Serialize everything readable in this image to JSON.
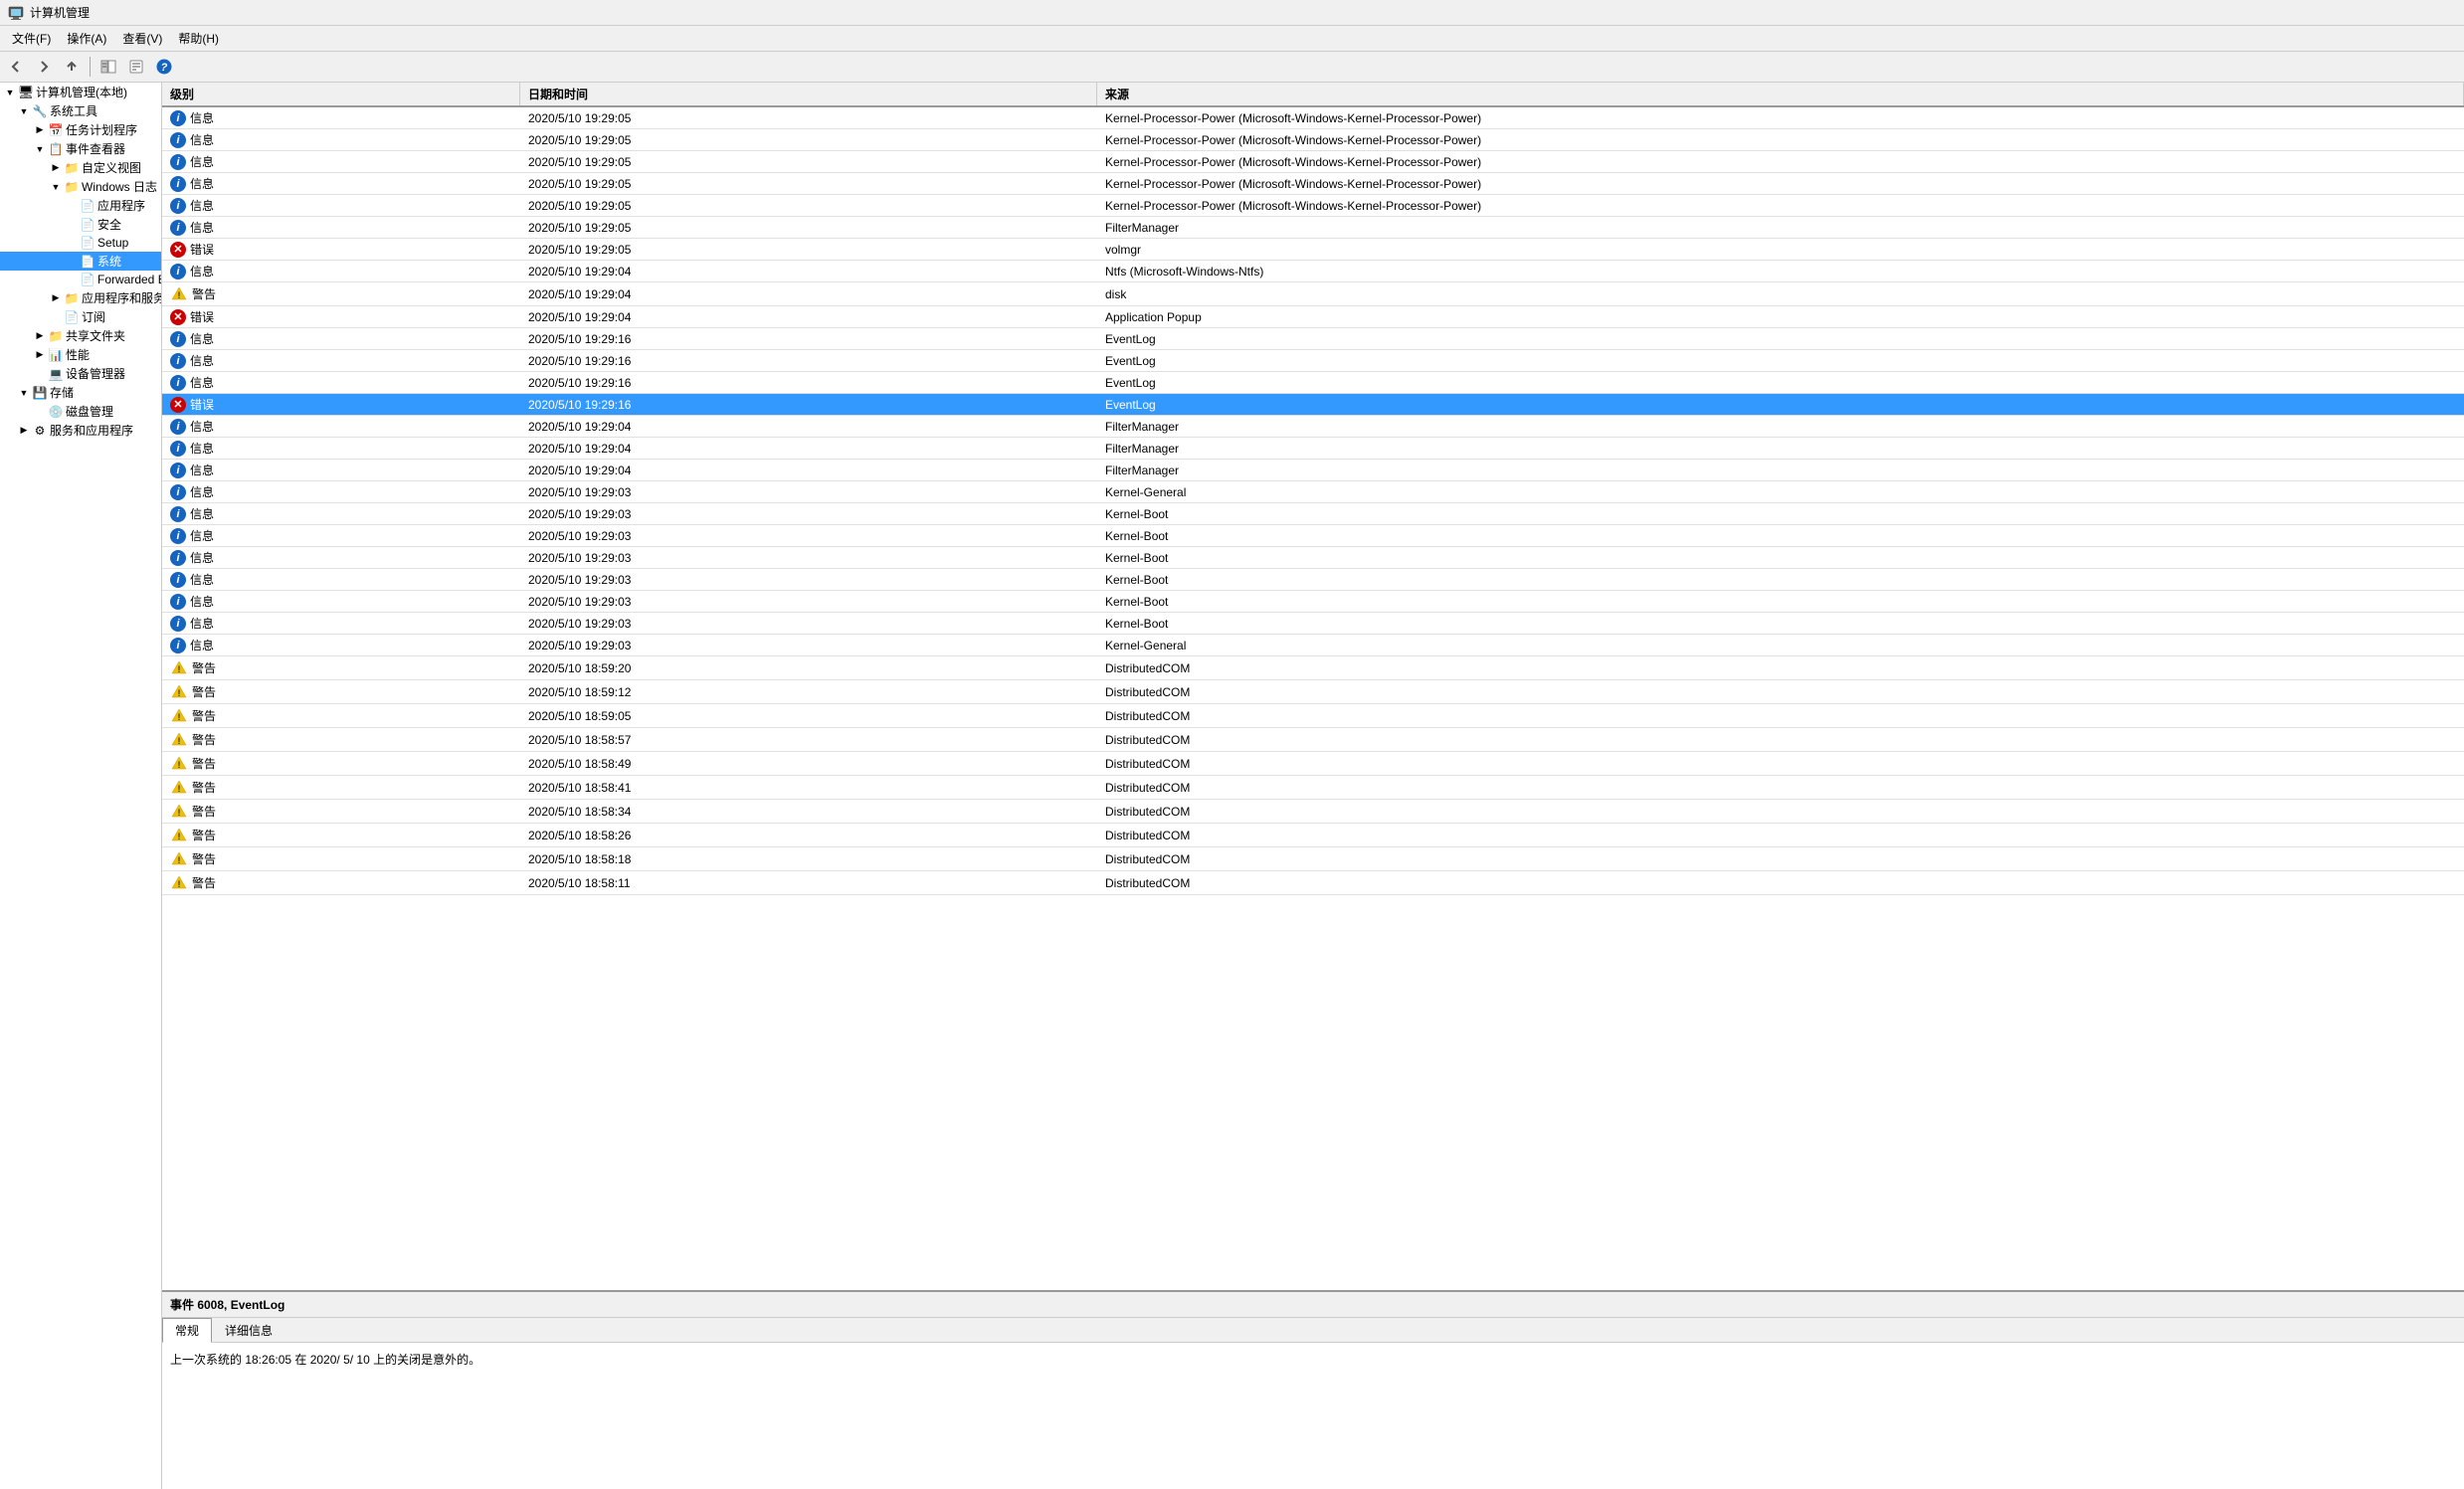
{
  "titleBar": {
    "title": "计算机管理",
    "icon": "computer-management-icon"
  },
  "menuBar": {
    "items": [
      {
        "id": "file",
        "label": "文件(F)"
      },
      {
        "id": "action",
        "label": "操作(A)"
      },
      {
        "id": "view",
        "label": "查看(V)"
      },
      {
        "id": "help",
        "label": "帮助(H)"
      }
    ]
  },
  "toolbar": {
    "buttons": [
      "back",
      "forward",
      "up",
      "show-hide-console-tree",
      "properties",
      "help"
    ]
  },
  "leftPanel": {
    "root": {
      "label": "计算机管理(本地)",
      "expanded": true,
      "children": [
        {
          "label": "系统工具",
          "expanded": true,
          "children": [
            {
              "label": "任务计划程序",
              "expanded": false
            },
            {
              "label": "事件查看器",
              "expanded": true,
              "children": [
                {
                  "label": "自定义视图",
                  "expanded": false
                },
                {
                  "label": "Windows 日志",
                  "expanded": true,
                  "children": [
                    {
                      "label": "应用程序"
                    },
                    {
                      "label": "安全"
                    },
                    {
                      "label": "Setup"
                    },
                    {
                      "label": "系统",
                      "selected": true
                    },
                    {
                      "label": "Forwarded Even..."
                    }
                  ]
                },
                {
                  "label": "应用程序和服务日志",
                  "expanded": false
                },
                {
                  "label": "订阅"
                }
              ]
            },
            {
              "label": "共享文件夹",
              "expanded": false
            },
            {
              "label": "性能",
              "expanded": false
            },
            {
              "label": "设备管理器"
            }
          ]
        },
        {
          "label": "存储",
          "expanded": false,
          "children": [
            {
              "label": "磁盘管理"
            }
          ]
        },
        {
          "label": "服务和应用程序",
          "expanded": false
        }
      ]
    }
  },
  "listHeader": {
    "columns": [
      {
        "id": "level",
        "label": "级别"
      },
      {
        "id": "datetime",
        "label": "日期和时间"
      },
      {
        "id": "source",
        "label": "来源"
      }
    ]
  },
  "eventList": {
    "rows": [
      {
        "type": "info",
        "level": "信息",
        "datetime": "2020/5/10 19:29:05",
        "source": "Kernel-Processor-Power (Microsoft-Windows-Kernel-Processor-Power)"
      },
      {
        "type": "info",
        "level": "信息",
        "datetime": "2020/5/10 19:29:05",
        "source": "Kernel-Processor-Power (Microsoft-Windows-Kernel-Processor-Power)"
      },
      {
        "type": "info",
        "level": "信息",
        "datetime": "2020/5/10 19:29:05",
        "source": "Kernel-Processor-Power (Microsoft-Windows-Kernel-Processor-Power)"
      },
      {
        "type": "info",
        "level": "信息",
        "datetime": "2020/5/10 19:29:05",
        "source": "Kernel-Processor-Power (Microsoft-Windows-Kernel-Processor-Power)"
      },
      {
        "type": "info",
        "level": "信息",
        "datetime": "2020/5/10 19:29:05",
        "source": "Kernel-Processor-Power (Microsoft-Windows-Kernel-Processor-Power)"
      },
      {
        "type": "info",
        "level": "信息",
        "datetime": "2020/5/10 19:29:05",
        "source": "FilterManager"
      },
      {
        "type": "error",
        "level": "错误",
        "datetime": "2020/5/10 19:29:05",
        "source": "volmgr"
      },
      {
        "type": "info",
        "level": "信息",
        "datetime": "2020/5/10 19:29:04",
        "source": "Ntfs (Microsoft-Windows-Ntfs)"
      },
      {
        "type": "warning",
        "level": "警告",
        "datetime": "2020/5/10 19:29:04",
        "source": "disk"
      },
      {
        "type": "error",
        "level": "错误",
        "datetime": "2020/5/10 19:29:04",
        "source": "Application Popup"
      },
      {
        "type": "info",
        "level": "信息",
        "datetime": "2020/5/10 19:29:16",
        "source": "EventLog"
      },
      {
        "type": "info",
        "level": "信息",
        "datetime": "2020/5/10 19:29:16",
        "source": "EventLog"
      },
      {
        "type": "info",
        "level": "信息",
        "datetime": "2020/5/10 19:29:16",
        "source": "EventLog"
      },
      {
        "type": "error",
        "level": "错误",
        "datetime": "2020/5/10 19:29:16",
        "source": "EventLog",
        "selected": true
      },
      {
        "type": "info",
        "level": "信息",
        "datetime": "2020/5/10 19:29:04",
        "source": "FilterManager"
      },
      {
        "type": "info",
        "level": "信息",
        "datetime": "2020/5/10 19:29:04",
        "source": "FilterManager"
      },
      {
        "type": "info",
        "level": "信息",
        "datetime": "2020/5/10 19:29:04",
        "source": "FilterManager"
      },
      {
        "type": "info",
        "level": "信息",
        "datetime": "2020/5/10 19:29:03",
        "source": "Kernel-General"
      },
      {
        "type": "info",
        "level": "信息",
        "datetime": "2020/5/10 19:29:03",
        "source": "Kernel-Boot"
      },
      {
        "type": "info",
        "level": "信息",
        "datetime": "2020/5/10 19:29:03",
        "source": "Kernel-Boot"
      },
      {
        "type": "info",
        "level": "信息",
        "datetime": "2020/5/10 19:29:03",
        "source": "Kernel-Boot"
      },
      {
        "type": "info",
        "level": "信息",
        "datetime": "2020/5/10 19:29:03",
        "source": "Kernel-Boot"
      },
      {
        "type": "info",
        "level": "信息",
        "datetime": "2020/5/10 19:29:03",
        "source": "Kernel-Boot"
      },
      {
        "type": "info",
        "level": "信息",
        "datetime": "2020/5/10 19:29:03",
        "source": "Kernel-Boot"
      },
      {
        "type": "info",
        "level": "信息",
        "datetime": "2020/5/10 19:29:03",
        "source": "Kernel-General"
      },
      {
        "type": "warning",
        "level": "警告",
        "datetime": "2020/5/10 18:59:20",
        "source": "DistributedCOM"
      },
      {
        "type": "warning",
        "level": "警告",
        "datetime": "2020/5/10 18:59:12",
        "source": "DistributedCOM"
      },
      {
        "type": "warning",
        "level": "警告",
        "datetime": "2020/5/10 18:59:05",
        "source": "DistributedCOM"
      },
      {
        "type": "warning",
        "level": "警告",
        "datetime": "2020/5/10 18:58:57",
        "source": "DistributedCOM"
      },
      {
        "type": "warning",
        "level": "警告",
        "datetime": "2020/5/10 18:58:49",
        "source": "DistributedCOM"
      },
      {
        "type": "warning",
        "level": "警告",
        "datetime": "2020/5/10 18:58:41",
        "source": "DistributedCOM"
      },
      {
        "type": "warning",
        "level": "警告",
        "datetime": "2020/5/10 18:58:34",
        "source": "DistributedCOM"
      },
      {
        "type": "warning",
        "level": "警告",
        "datetime": "2020/5/10 18:58:26",
        "source": "DistributedCOM"
      },
      {
        "type": "warning",
        "level": "警告",
        "datetime": "2020/5/10 18:58:18",
        "source": "DistributedCOM"
      },
      {
        "type": "warning",
        "level": "警告",
        "datetime": "2020/5/10 18:58:11",
        "source": "DistributedCOM"
      }
    ]
  },
  "detailPanel": {
    "eventTitle": "事件 6008, EventLog",
    "tabs": [
      {
        "id": "general",
        "label": "常规",
        "active": true
      },
      {
        "id": "detail",
        "label": "详细信息",
        "active": false
      }
    ],
    "content": "上一次系统的 18:26:05 在   2020/  5/  10 上的关闭是意外的。"
  }
}
